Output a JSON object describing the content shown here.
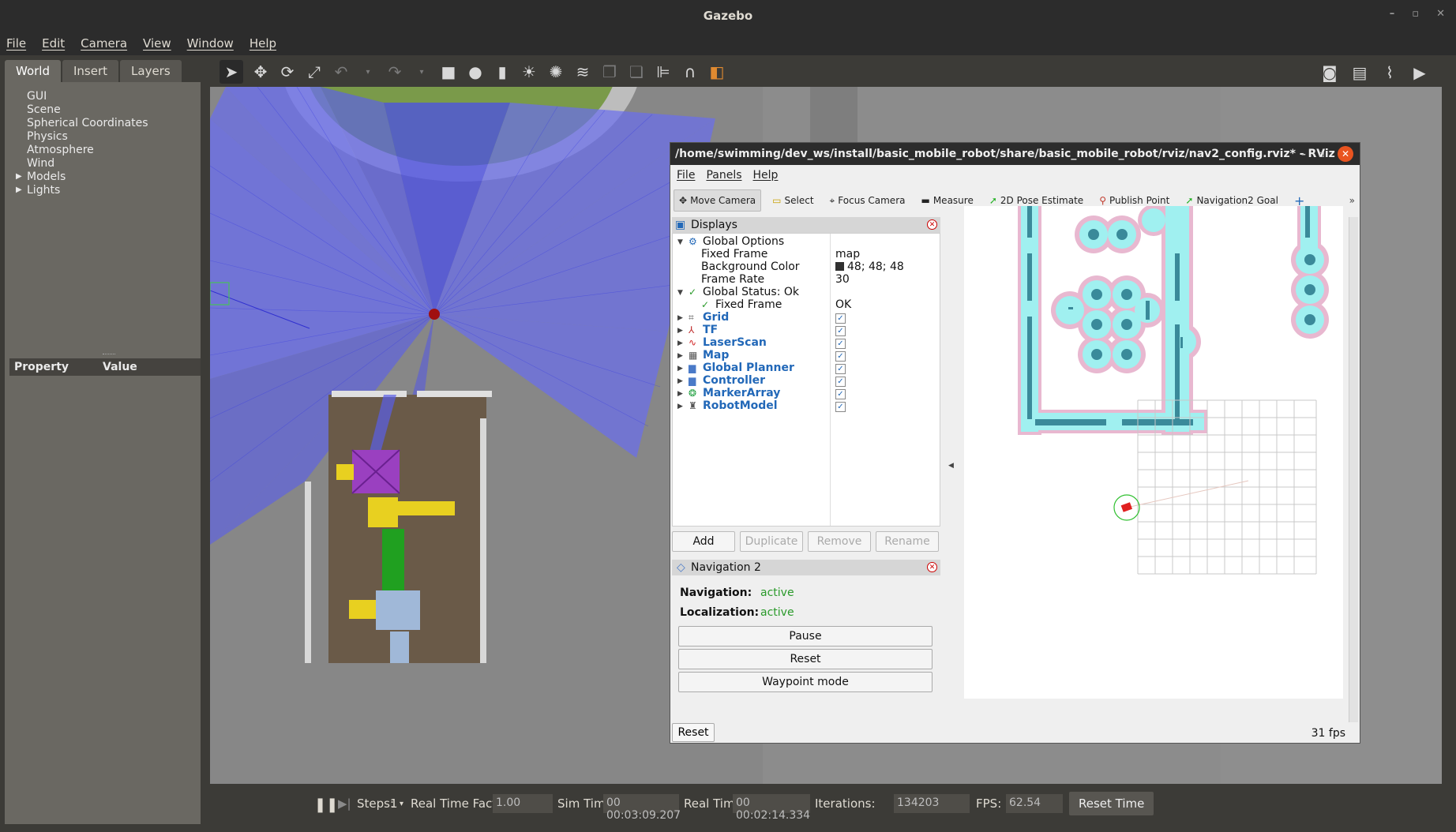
{
  "app": {
    "title": "Gazebo",
    "window_controls": [
      "–",
      "▫",
      "✕"
    ],
    "menu": [
      "File",
      "Edit",
      "Camera",
      "View",
      "Window",
      "Help"
    ]
  },
  "left_panel": {
    "tabs": [
      "World",
      "Insert",
      "Layers"
    ],
    "world_items": [
      "GUI",
      "Scene",
      "Spherical Coordinates",
      "Physics",
      "Atmosphere",
      "Wind",
      "Models",
      "Lights"
    ],
    "property_header": "Property",
    "value_header": "Value"
  },
  "bottom": {
    "steps_label": "Steps:",
    "steps_value": "1",
    "rtf_label": "Real Time Factor:",
    "rtf_value": "1.00",
    "sim_time_label": "Sim Time:",
    "sim_time_value": "00 00:03:09.207",
    "real_time_label": "Real Time:",
    "real_time_value": "00 00:02:14.334",
    "iterations_label": "Iterations:",
    "iterations_value": "134203",
    "fps_label": "FPS:",
    "fps_value": "62.54",
    "reset_time": "Reset Time"
  },
  "rviz": {
    "title": "/home/swimming/dev_ws/install/basic_mobile_robot/share/basic_mobile_robot/rviz/nav2_config.rviz* - RViz",
    "menu": [
      "File",
      "Panels",
      "Help"
    ],
    "tools": [
      "Move Camera",
      "Select",
      "Focus Camera",
      "Measure",
      "2D Pose Estimate",
      "Publish Point",
      "Navigation2 Goal"
    ],
    "displays_title": "Displays",
    "global_options": "Global Options",
    "fixed_frame_label": "Fixed Frame",
    "fixed_frame_value": "map",
    "bg_color_label": "Background Color",
    "bg_color_value": "48; 48; 48",
    "frame_rate_label": "Frame Rate",
    "frame_rate_value": "30",
    "global_status": "Global Status: Ok",
    "status_fixed_frame": "Fixed Frame",
    "status_ok": "OK",
    "displays": [
      "Grid",
      "TF",
      "LaserScan",
      "Map",
      "Global Planner",
      "Controller",
      "MarkerArray",
      "RobotModel"
    ],
    "buttons": [
      "Add",
      "Duplicate",
      "Remove",
      "Rename"
    ],
    "nav2_title": "Navigation 2",
    "navigation_label": "Navigation:",
    "navigation_value": "active",
    "localization_label": "Localization:",
    "localization_value": "active",
    "pause": "Pause",
    "reset": "Reset",
    "waypoint_mode": "Waypoint mode",
    "bottom_reset": "Reset",
    "fps": "31 fps"
  },
  "colors": {
    "gazebo_bg": "#3c3b37",
    "laser_blue": "#5a5af0",
    "rviz_accent": "#2268b8",
    "status_green": "#2a9a2a",
    "costmap_cyan": "#a0f0f0",
    "costmap_pink": "#e8b8d0"
  }
}
